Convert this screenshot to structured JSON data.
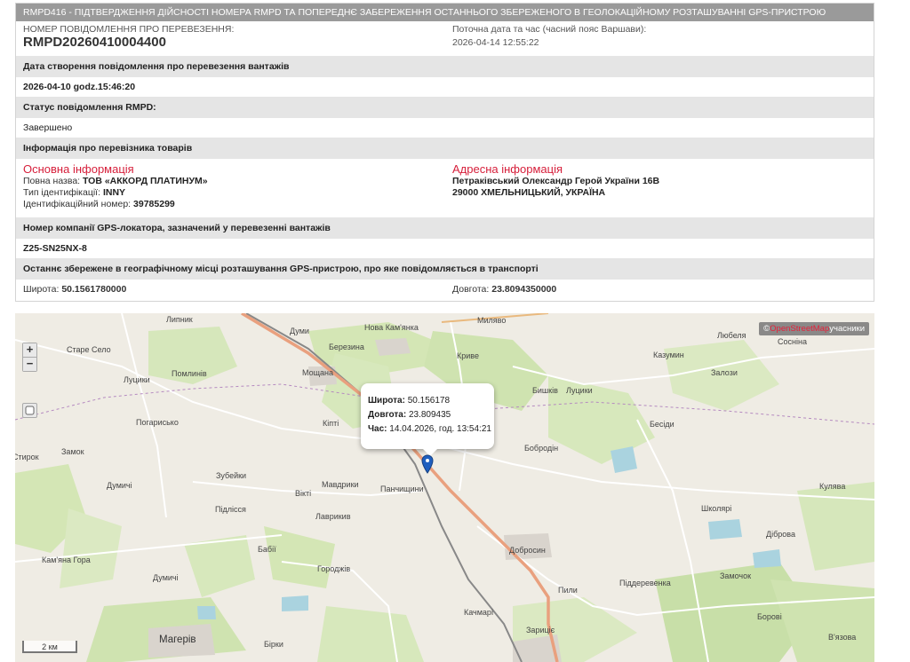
{
  "header": {
    "title": "RMPD416 - ПІДТВЕРДЖЕННЯ ДІЙСНОСТІ НОМЕРА RMPD ТА ПОПЕРЕДНЄ ЗАБЕРЕЖЕННЯ ОСТАННЬОГО ЗБЕРЕЖЕНОГО В ГЕОЛОКАЦІЙНОМУ РОЗТАШУВАННІ GPS-ПРИСТРОЮ"
  },
  "info": {
    "number_label": "НОМЕР ПОВІДОМЛЕННЯ ПРО ПЕРЕВЕЗЕННЯ:",
    "number_value": "RMPD20260410004400",
    "datetime_label": "Поточна дата та час (часний пояс Варшави):",
    "datetime_value": "2026-04-14 12:55:22"
  },
  "sections": {
    "created_title": "Дата створення повідомлення про перевезення вантажів",
    "created_value": "2026-04-10 godz.15:46:20",
    "status_title": "Статус повідомлення RMPD:",
    "status_value": "Завершено",
    "carrier_title": "Інформація про перевізника товарів",
    "gps_company_title": "Номер компанії GPS-локатора, зазначений у перевезенні вантажів",
    "gps_company_value": "Z25-SN25NX-8",
    "last_location_title": "Останнє збережене в географічному місці розташування GPS-пристрою, про яке повідомляється в транспорті"
  },
  "carrier": {
    "basic_title": "Основна інформація",
    "name_label": "Повна назва:",
    "name_value": "ТОВ «АККОРД ПЛАТИНУМ»",
    "idtype_label": "Тип ідентифікації:",
    "idtype_value": "INNY",
    "idnum_label": "Ідентифікаційний номер:",
    "idnum_value": "39785299",
    "address_title": "Адресна інформація",
    "address_line1": "Петраківський Олександр Герой України 16В",
    "address_line2": "29000 ХМЕЛЬНИЦЬКИЙ, УКРАЇНА"
  },
  "location": {
    "lat_label": "Широта:",
    "lat_value": "50.1561780000",
    "lon_label": "Довгота:",
    "lon_value": "23.8094350000"
  },
  "map": {
    "zoom_in": "+",
    "zoom_out": "−",
    "attribution_copy": "©",
    "attribution_osm": "OpenStreetMap",
    "attribution_rest": "учасники",
    "scale": "2 км",
    "popup": {
      "lat_label": "Широта:",
      "lat_value": "50.156178",
      "lon_label": "Довгота:",
      "lon_value": "23.809435",
      "time_label": "Час:",
      "time_value": "14.04.2026, год. 13:54:21"
    },
    "places": [
      "Липник",
      "Миляво",
      "Думи",
      "Нова Кам'янка",
      "Березина",
      "Любеля",
      "Сосніна",
      "Старе Село",
      "Мощана",
      "Криве",
      "Казумин",
      "Залози",
      "Луцики",
      "Помлинів",
      "Бишків",
      "Луцики",
      "Погарисько",
      "Кіпті",
      "Бесіди",
      "Замок",
      "Бобродін",
      "Зубейки",
      "Мавдрики",
      "Панчищини",
      "Кулява",
      "Думичі",
      "Вікті",
      "Підлісся",
      "Лаврикив",
      "Школярі",
      "Діброва",
      "Бабії",
      "Добросин",
      "Кам'яна Гора",
      "Городжів",
      "Думичі",
      "Пили",
      "Піддеревенка",
      "Замочок",
      "Качмарі",
      "Зариціє",
      "Борові",
      "Магерів",
      "Бірки",
      "В'язова",
      "Стирок"
    ]
  },
  "colors": {
    "header_bg": "#9a9a9a",
    "section_bg": "#e5e5e5",
    "accent_red": "#d61e3a",
    "marker": "#1f5fbf",
    "road": "#e9a07e"
  }
}
